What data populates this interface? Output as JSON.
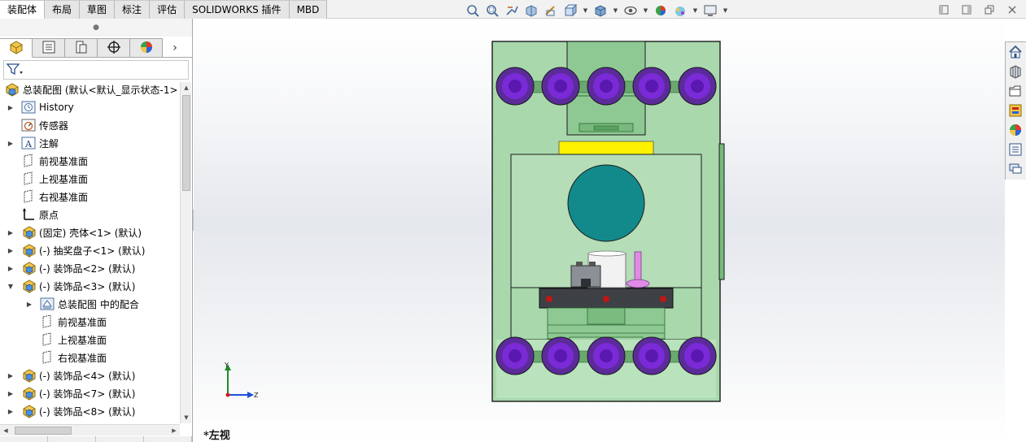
{
  "command_tabs": [
    "装配体",
    "布局",
    "草图",
    "标注",
    "评估",
    "SOLIDWORKS 插件",
    "MBD"
  ],
  "active_tab": "装配体",
  "heads_up_toolbar": [
    "zoom-to-fit-icon",
    "zoom-to-area-icon",
    "previous-view-icon",
    "section-view-icon",
    "dynamic-annotation-icon",
    "view-orientation-icon",
    "display-style-icon",
    "hide-show-items-icon",
    "edit-appearance-icon",
    "apply-scene-icon",
    "view-settings-icon"
  ],
  "panel_tabs": [
    "featuremanager-icon",
    "propertymanager-icon",
    "configurationmanager-icon",
    "dimxpertmanager-icon",
    "displaymanager-icon"
  ],
  "tree": [
    {
      "label": "总装配图  (默认<默认_显示状态-1>",
      "icon": "assembly-icon",
      "indent": 0,
      "expander": ""
    },
    {
      "label": "History",
      "icon": "history-icon",
      "indent": 1,
      "expander": "▶"
    },
    {
      "label": "传感器",
      "icon": "sensor-icon",
      "indent": 1,
      "expander": ""
    },
    {
      "label": "注解",
      "icon": "annotation-icon",
      "indent": 1,
      "expander": "▶"
    },
    {
      "label": "前视基准面",
      "icon": "plane-icon",
      "indent": 1,
      "expander": ""
    },
    {
      "label": "上视基准面",
      "icon": "plane-icon",
      "indent": 1,
      "expander": ""
    },
    {
      "label": "右视基准面",
      "icon": "plane-icon",
      "indent": 1,
      "expander": ""
    },
    {
      "label": "原点",
      "icon": "origin-icon",
      "indent": 1,
      "expander": ""
    },
    {
      "label": "(固定) 壳体<1> (默认)",
      "icon": "component-icon",
      "indent": 1,
      "expander": "▶"
    },
    {
      "label": "(-) 抽奖盘子<1> (默认)",
      "icon": "component-icon",
      "indent": 1,
      "expander": "▶"
    },
    {
      "label": "(-) 装饰品<2> (默认)",
      "icon": "component-icon",
      "indent": 1,
      "expander": "▶"
    },
    {
      "label": "(-) 装饰品<3> (默认)",
      "icon": "component-icon",
      "indent": 1,
      "expander": "▼"
    },
    {
      "label": "总装配图 中的配合",
      "icon": "mates-icon",
      "indent": 2,
      "expander": "▶"
    },
    {
      "label": "前视基准面",
      "icon": "plane-icon",
      "indent": 2,
      "expander": ""
    },
    {
      "label": "上视基准面",
      "icon": "plane-icon",
      "indent": 2,
      "expander": ""
    },
    {
      "label": "右视基准面",
      "icon": "plane-icon",
      "indent": 2,
      "expander": ""
    },
    {
      "label": "(-) 装饰品<4> (默认)",
      "icon": "component-icon",
      "indent": 1,
      "expander": "▶"
    },
    {
      "label": "(-) 装饰品<7> (默认)",
      "icon": "component-icon",
      "indent": 1,
      "expander": "▶"
    },
    {
      "label": "(-) 装饰品<8> (默认)",
      "icon": "component-icon",
      "indent": 1,
      "expander": "▶"
    }
  ],
  "view_name": "*左视",
  "triad": {
    "y": "Y",
    "z": "Z"
  },
  "task_pane": [
    "home-icon",
    "design-library-icon",
    "file-explorer-icon",
    "view-palette-icon",
    "appearances-icon",
    "custom-properties-icon",
    "forum-icon"
  ],
  "colors": {
    "body_green": "#a8d9ac",
    "frame_stroke": "#1a1a1a",
    "wheel_purple": "#6a1fc2",
    "big_disc": "#128a8c",
    "yellow_bar": "#fff200",
    "dark_plate": "#3d4045",
    "magenta_part": "#e08be6"
  }
}
